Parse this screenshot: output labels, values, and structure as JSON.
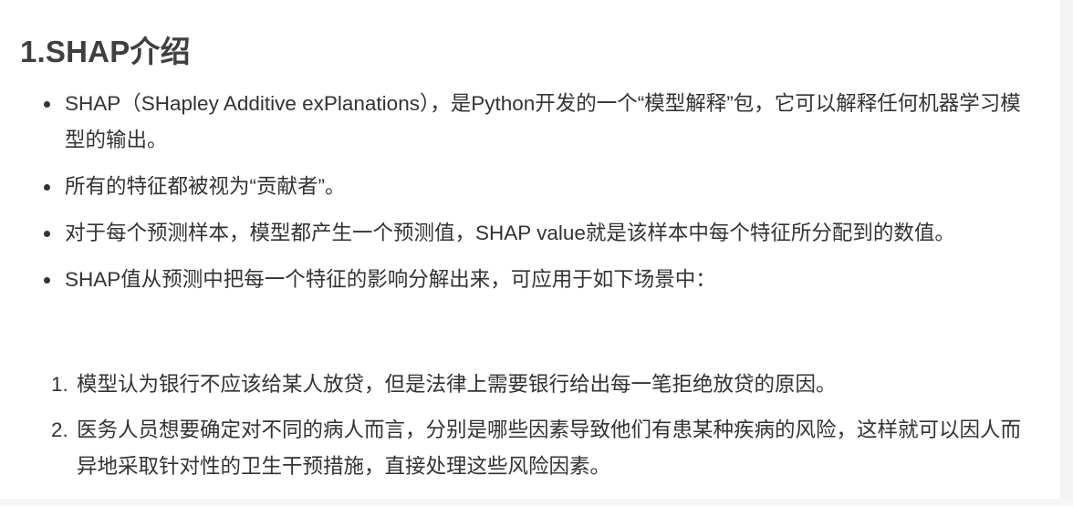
{
  "section": {
    "heading": "1.SHAP介绍"
  },
  "bullets": [
    {
      "text": "SHAP（SHapley Additive exPlanations），是Python开发的一个“模型解释”包，它可以解释任何机器学习模型的输出。"
    },
    {
      "text": "所有的特征都被视为“贡献者”。"
    },
    {
      "text": "对于每个预测样本，模型都产生一个预测值，SHAP value就是该样本中每个特征所分配到的数值。"
    },
    {
      "text": "SHAP值从预测中把每一个特征的影响分解出来，可应用于如下场景中："
    }
  ],
  "scenarios": [
    {
      "number": "1.",
      "text": "模型认为银行不应该给某人放贷，但是法律上需要银行给出每一笔拒绝放贷的原因。"
    },
    {
      "number": "2.",
      "text": "医务人员想要确定对不同的病人而言，分别是哪些因素导致他们有患某种疾病的风险，这样就可以因人而异地采取针对性的卫生干预措施，直接处理这些风险因素。"
    }
  ]
}
